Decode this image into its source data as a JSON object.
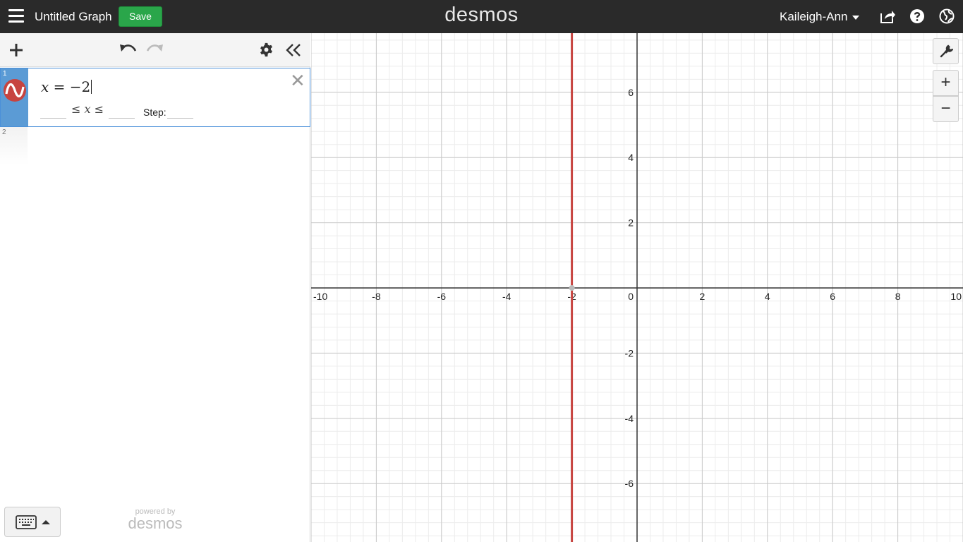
{
  "header": {
    "graph_title": "Untitled Graph",
    "save_label": "Save",
    "logo_text": "desmos",
    "user_name": "Kaileigh-Ann"
  },
  "panel": {
    "expressions": [
      {
        "number": "1",
        "latex_display": {
          "var": "x",
          "op": "=",
          "value": "−2"
        },
        "domain": {
          "lower": "",
          "var": "x",
          "upper": "",
          "leq": "≤",
          "step_label": "Step:",
          "step": ""
        },
        "color": "#c74440"
      },
      {
        "number": "2"
      }
    ],
    "powered_by": "powered by",
    "powered_logo": "desmos"
  },
  "graph": {
    "line_color": "#c74440",
    "x_ticks": [
      "-10",
      "-8",
      "-6",
      "-4",
      "-2",
      "0",
      "2",
      "4",
      "6",
      "8",
      "10"
    ],
    "y_ticks": [
      "6",
      "4",
      "2",
      "-2",
      "-4",
      "-6"
    ],
    "graphed_line": {
      "type": "vertical",
      "x": -2
    },
    "x_range": [
      -10,
      10
    ],
    "y_range": [
      -7.8,
      7.8
    ],
    "zoom_in": "+",
    "zoom_out": "−"
  },
  "icons": [
    "menu-icon",
    "share-icon",
    "help-icon",
    "globe-icon",
    "add-icon",
    "undo-icon",
    "redo-icon",
    "gear-icon",
    "collapse-icon",
    "wrench-icon",
    "keyboard-icon",
    "expression-color-icon",
    "close-icon"
  ]
}
